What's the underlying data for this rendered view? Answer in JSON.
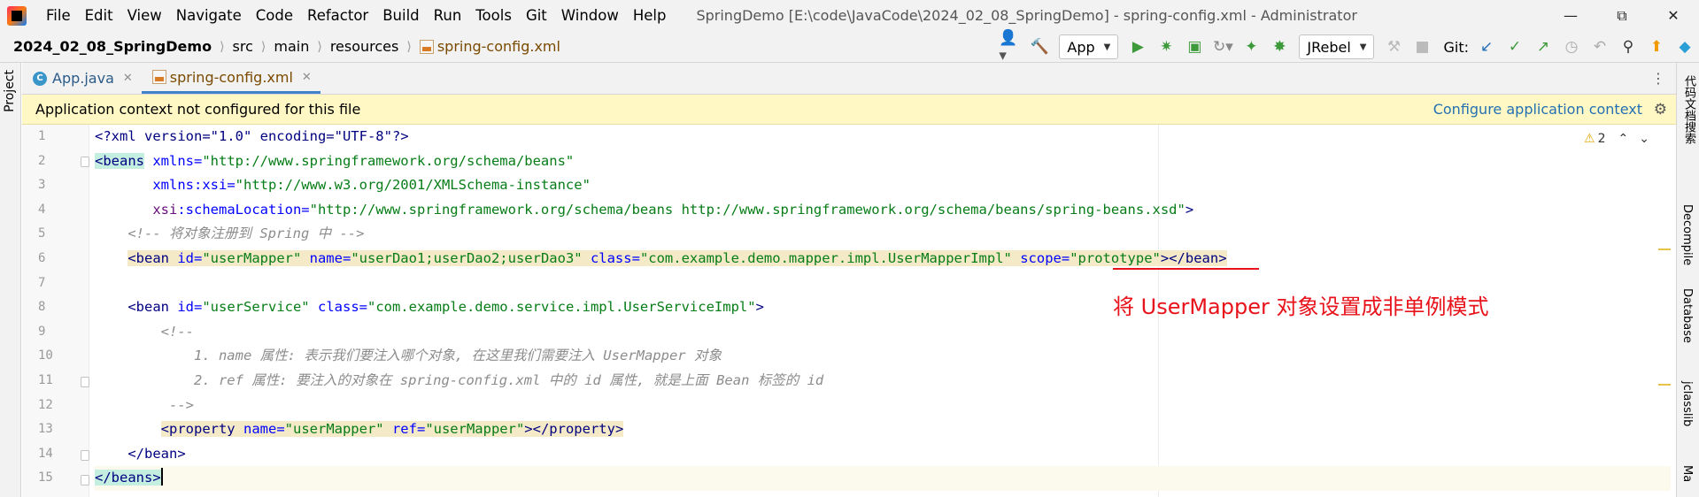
{
  "titlebar": {
    "menu": [
      "File",
      "Edit",
      "View",
      "Navigate",
      "Code",
      "Refactor",
      "Build",
      "Run",
      "Tools",
      "Git",
      "Window",
      "Help"
    ],
    "window_title": "SpringDemo [E:\\code\\JavaCode\\2024_02_08_SpringDemo] - spring-config.xml - Administrator"
  },
  "breadcrumb": {
    "project": "2024_02_08_SpringDemo",
    "src": "src",
    "main": "main",
    "resources": "resources",
    "file": "spring-config.xml"
  },
  "toolbar": {
    "run_config": "App",
    "jrebel": "JRebel",
    "git_label": "Git:"
  },
  "left_stripe": {
    "project_label": "Project"
  },
  "right_stripe": {
    "items": [
      "代码文档搜索",
      "Decompile",
      "Database",
      "jclasslib",
      "Ma"
    ]
  },
  "tabs": [
    {
      "label": "App.java"
    },
    {
      "label": "spring-config.xml"
    }
  ],
  "banner": {
    "message": "Application context not configured for this file",
    "link": "Configure application context"
  },
  "editor": {
    "line_numbers": [
      "1",
      "2",
      "3",
      "4",
      "5",
      "6",
      "7",
      "8",
      "9",
      "10",
      "11",
      "12",
      "13",
      "14",
      "15"
    ],
    "warnings_count": "2",
    "code": {
      "l1": "<?xml version=\"1.0\" encoding=\"UTF-8\"?>",
      "l2_tag": "<beans",
      "l2_attr": " xmlns=",
      "l2_val": "\"http://www.springframework.org/schema/beans\"",
      "l3_ns": "xmlns:xsi=",
      "l3_val": "\"http://www.w3.org/2001/XMLSchema-instance\"",
      "l4_ns": "xsi",
      "l4_attr": ":schemaLocation=",
      "l4_val": "\"http://www.springframework.org/schema/beans http://www.springframework.org/schema/beans/spring-beans.xsd\"",
      "l4_end": ">",
      "l5_comment": "<!-- 将对象注册到 Spring 中 -->",
      "l6_open": "<bean",
      "l6_a1": " id=",
      "l6_v1": "\"userMapper\"",
      "l6_a2": " name=",
      "l6_v2": "\"userDao1;userDao2;userDao3\"",
      "l6_a3": " class=",
      "l6_v3": "\"com.example.demo.mapper.impl.UserMapperImpl\"",
      "l6_a4": "scope=",
      "l6_v4": "\"prototype\"",
      "l6_close": "></bean>",
      "l8_open": "<bean",
      "l8_a1": " id=",
      "l8_v1": "\"userService\"",
      "l8_a2": " class=",
      "l8_v2": "\"com.example.demo.service.impl.UserServiceImpl\"",
      "l8_end": ">",
      "l9": "<!--",
      "l10": "1. name 属性: 表示我们要注入哪个对象, 在这里我们需要注入 UserMapper 对象",
      "l11": "2. ref 属性: 要注入的对象在 spring-config.xml 中的 id 属性, 就是上面 Bean 标签的 id",
      "l12": "-->",
      "l13_open": "<property",
      "l13_a1": " name=",
      "l13_v1": "\"userMapper\"",
      "l13_a2": " ref=",
      "l13_v2": "\"userMapper\"",
      "l13_close": "></property>",
      "l14": "</bean>",
      "l15": "</beans>"
    }
  },
  "annotation": "将 UserMapper 对象设置成非单例模式",
  "colors": {
    "accent": "#4083c9",
    "annotation": "#e8121a",
    "banner_bg": "#fff8c4",
    "link": "#2470b3"
  }
}
